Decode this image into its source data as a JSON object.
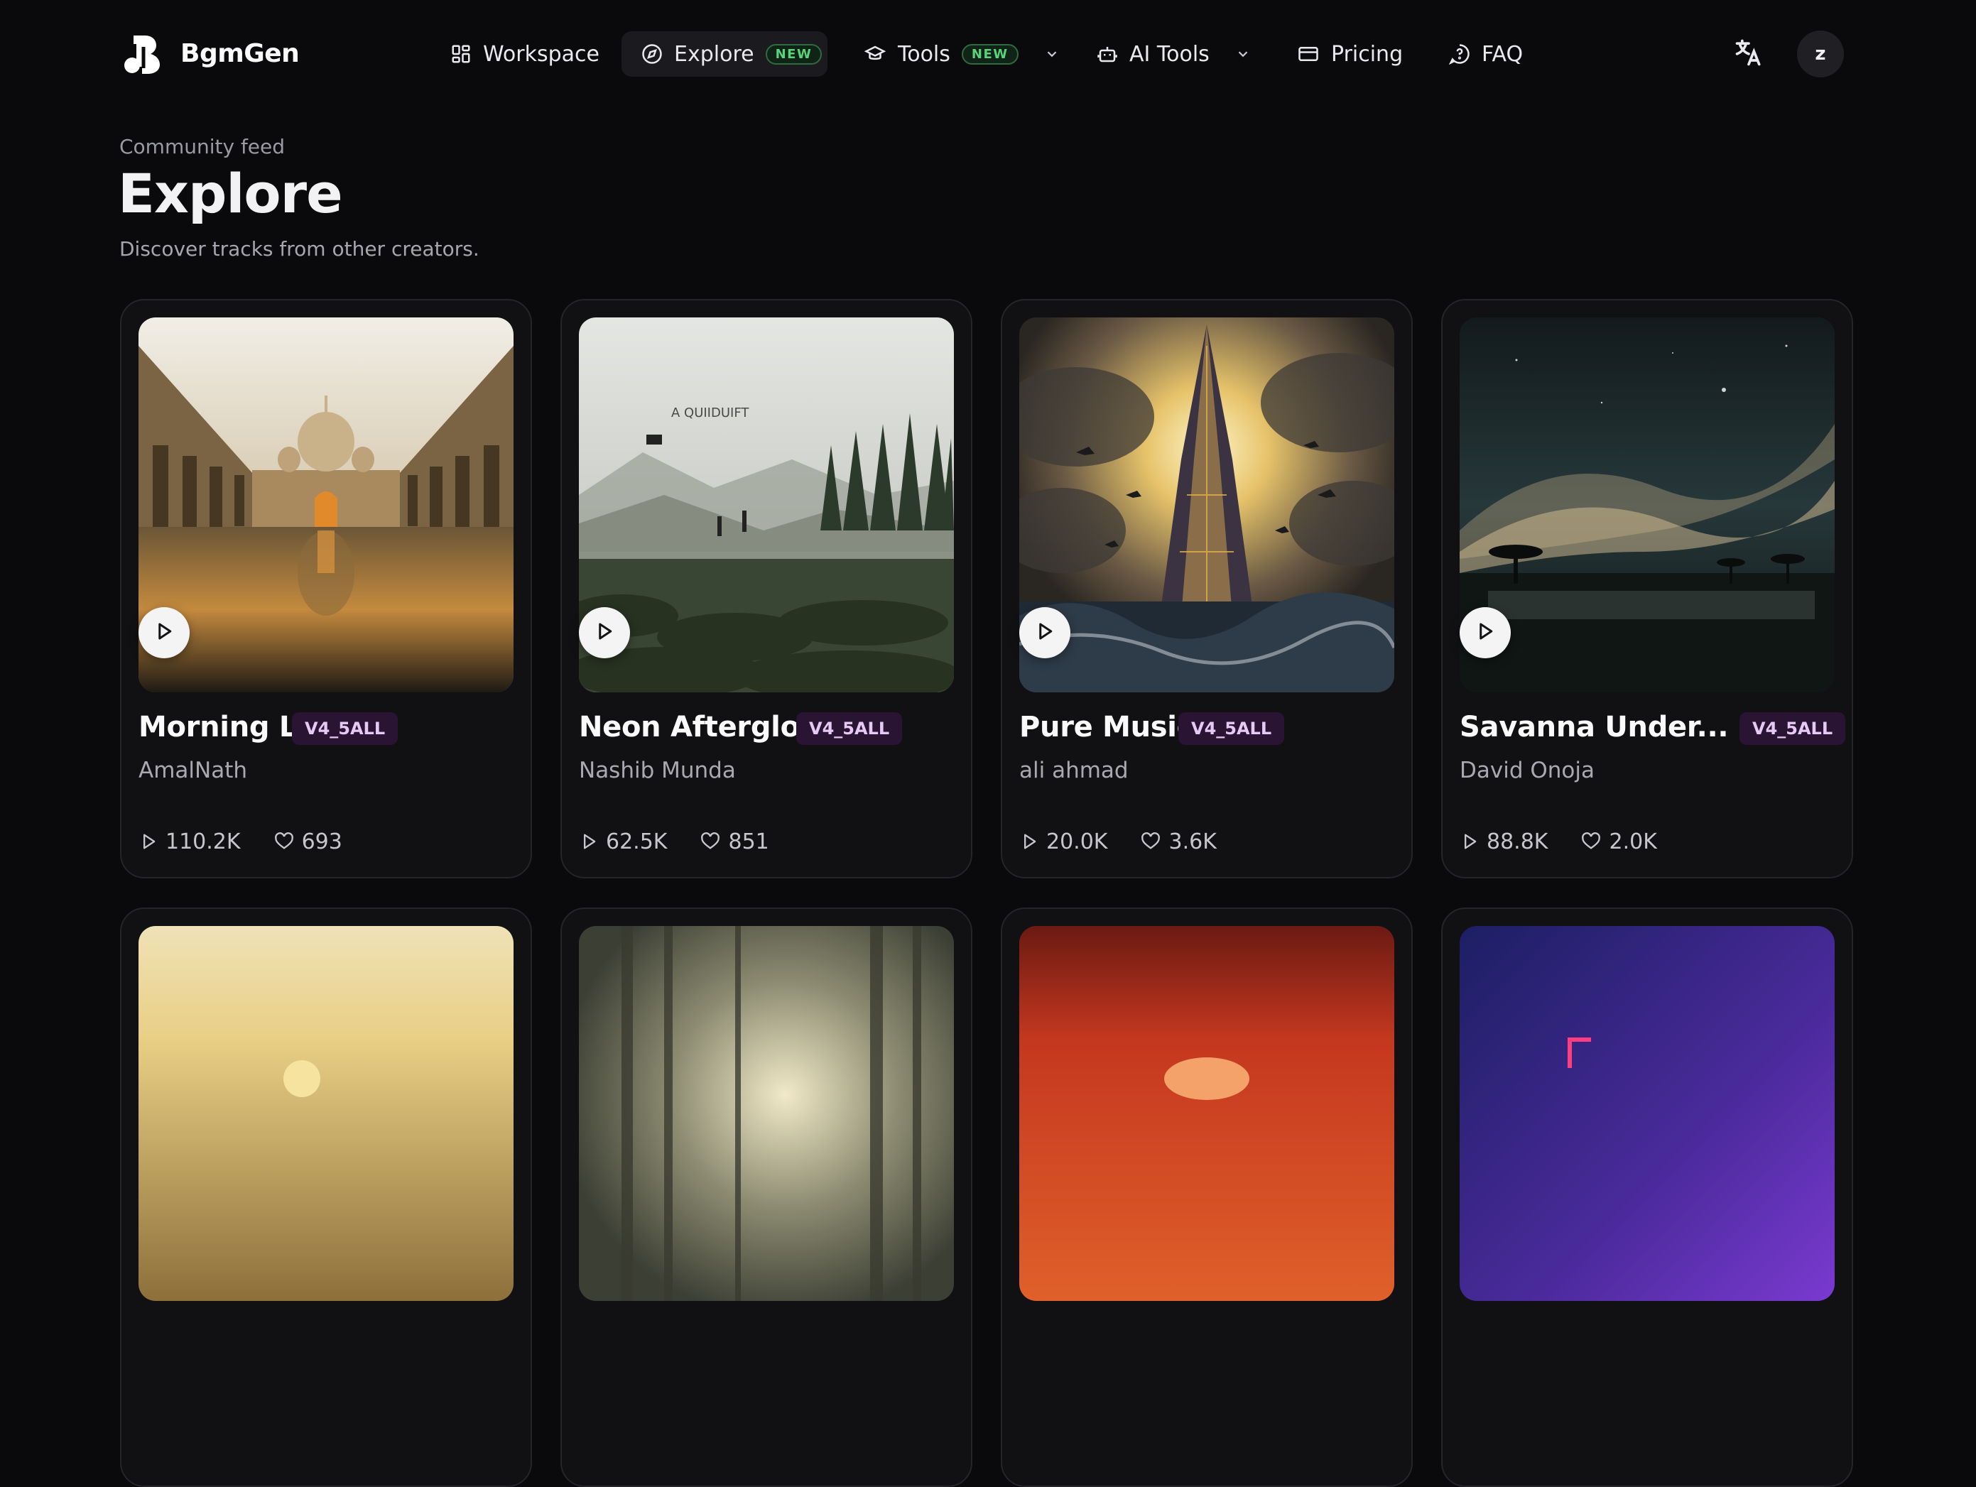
{
  "app": {
    "name": "BgmGen"
  },
  "nav": {
    "items": [
      {
        "label": "Workspace",
        "icon": "grid-icon"
      },
      {
        "label": "Explore",
        "icon": "compass-icon",
        "badge": "NEW",
        "active": true
      },
      {
        "label": "Tools",
        "icon": "graduation-cap-icon",
        "badge": "NEW",
        "dropdown": true
      },
      {
        "label": "AI Tools",
        "icon": "robot-icon",
        "dropdown": true
      },
      {
        "label": "Pricing",
        "icon": "credit-card-icon"
      },
      {
        "label": "FAQ",
        "icon": "help-circle-icon"
      }
    ],
    "translate_icon": "translate-icon",
    "avatar_initial": "z"
  },
  "header": {
    "eyebrow": "Community feed",
    "title": "Explore",
    "subtitle": "Discover tracks from other creators."
  },
  "tracks": [
    {
      "title": "Morning Lift",
      "model": "V4_5ALL",
      "author": "AmalNath",
      "plays": "110.2K",
      "likes": "693"
    },
    {
      "title": "Neon Afterglow",
      "model": "V4_5ALL",
      "author": "Nashib Munda",
      "plays": "62.5K",
      "likes": "851"
    },
    {
      "title": "Pure Music",
      "model": "V4_5ALL",
      "author": "ali ahmad",
      "plays": "20.0K",
      "likes": "3.6K"
    },
    {
      "title": "Savanna Under...",
      "model": "V4_5ALL",
      "author": "David Onoja",
      "plays": "88.8K",
      "likes": "2.0K"
    }
  ],
  "cover_texts": {
    "neon_afterglow": "A QUIIDUIFT"
  },
  "colors": {
    "accent_badge_bg": "#2a1433",
    "new_badge": "#59d27a",
    "background": "#0a0a0c"
  }
}
